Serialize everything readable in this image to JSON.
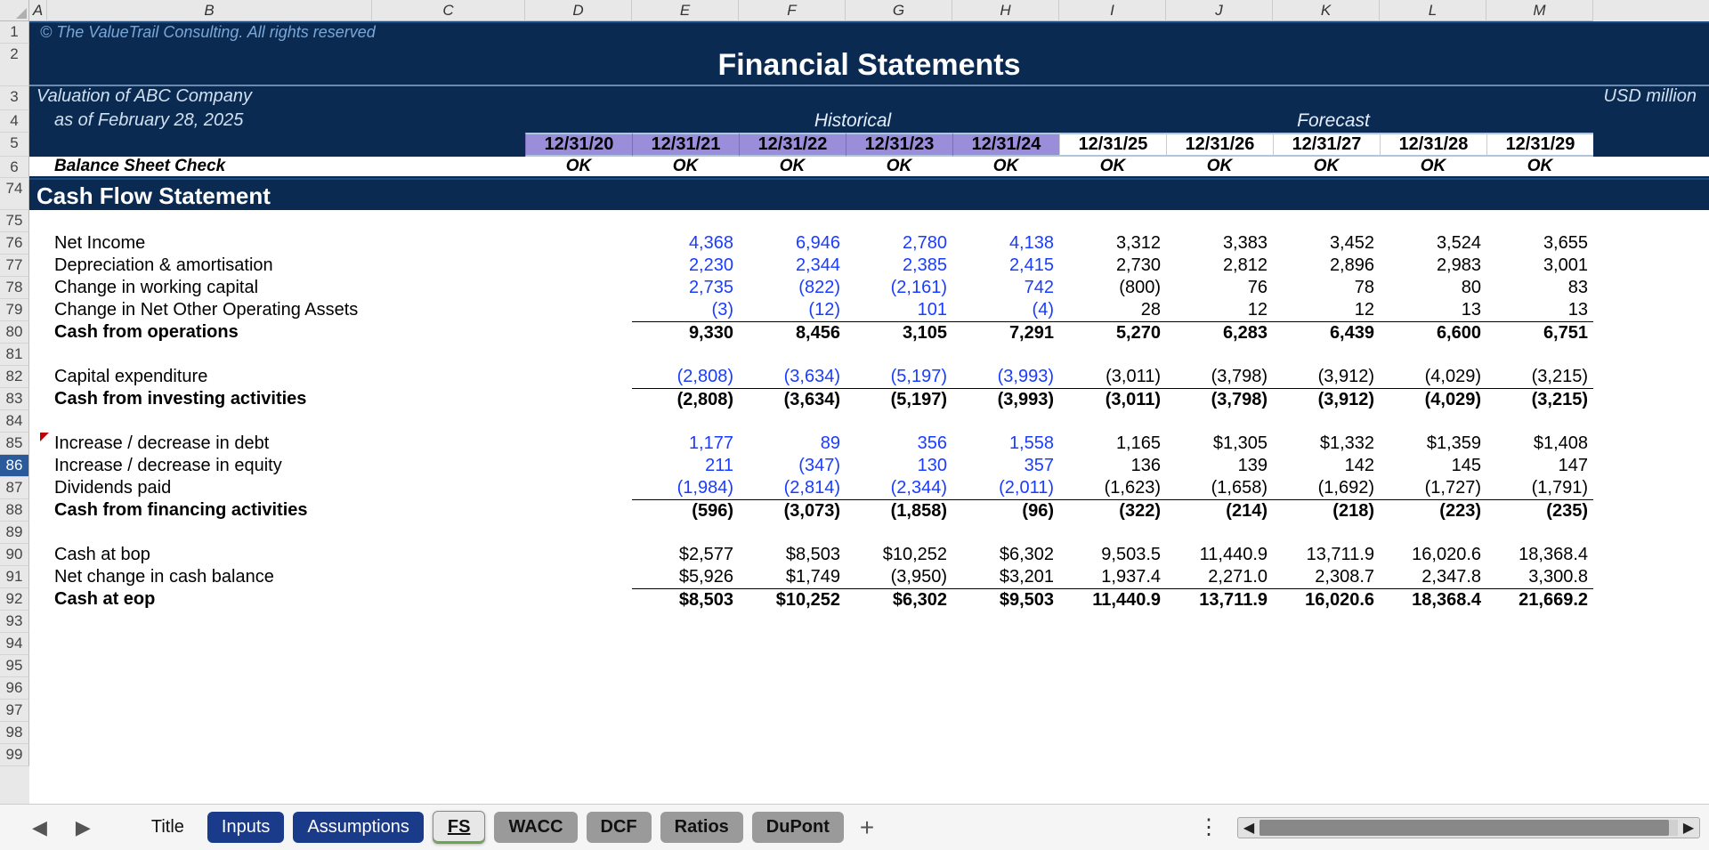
{
  "columns": [
    "A",
    "B",
    "C",
    "D",
    "E",
    "F",
    "G",
    "H",
    "I",
    "J",
    "K",
    "L",
    "M"
  ],
  "row_numbers_top": [
    1,
    2,
    3,
    4,
    5,
    6
  ],
  "row_numbers_mid": [
    74,
    75,
    76,
    77,
    78,
    79,
    80,
    81,
    82,
    83,
    84,
    85,
    86,
    87,
    88,
    89,
    90,
    91,
    92,
    93,
    94,
    95,
    96,
    97,
    98,
    99
  ],
  "selected_row": 86,
  "copyright": "© The ValueTrail Consulting. All rights reserved",
  "title": "Financial Statements",
  "subtitle1": "Valuation of  ABC Company",
  "subtitle2": "as of February 28, 2025",
  "section_hist": "Historical",
  "section_fore": "Forecast",
  "usd": "USD million",
  "dates": [
    "12/31/20",
    "12/31/21",
    "12/31/22",
    "12/31/23",
    "12/31/24",
    "12/31/25",
    "12/31/26",
    "12/31/27",
    "12/31/28",
    "12/31/29"
  ],
  "bs_check_label": "Balance Sheet Check",
  "ok": "OK",
  "section_header": "Cash Flow Statement",
  "rows": {
    "net_income": {
      "label": "Net Income",
      "blue": 4,
      "vals": [
        "4,368",
        "6,946",
        "2,780",
        "4,138",
        "3,312",
        "3,383",
        "3,452",
        "3,524",
        "3,655"
      ]
    },
    "dep_amort": {
      "label": "Depreciation & amortisation",
      "blue": 4,
      "vals": [
        "2,230",
        "2,344",
        "2,385",
        "2,415",
        "2,730",
        "2,812",
        "2,896",
        "2,983",
        "3,001"
      ]
    },
    "chg_wc": {
      "label": "Change in working capital",
      "blue": 4,
      "vals": [
        "2,735",
        "(822)",
        "(2,161)",
        "742",
        "(800)",
        "76",
        "78",
        "80",
        "83"
      ]
    },
    "chg_other": {
      "label": "Change in Net Other Operating Assets",
      "blue": 4,
      "vals": [
        "(3)",
        "(12)",
        "101",
        "(4)",
        "28",
        "12",
        "12",
        "13",
        "13"
      ]
    },
    "cash_ops": {
      "label": "Cash from operations",
      "bold": true,
      "sum": true,
      "vals": [
        "9,330",
        "8,456",
        "3,105",
        "7,291",
        "5,270",
        "6,283",
        "6,439",
        "6,600",
        "6,751"
      ]
    },
    "capex": {
      "label": "Capital expenditure",
      "blue": 4,
      "vals": [
        "(2,808)",
        "(3,634)",
        "(5,197)",
        "(3,993)",
        "(3,011)",
        "(3,798)",
        "(3,912)",
        "(4,029)",
        "(3,215)"
      ]
    },
    "cash_inv": {
      "label": "Cash from investing activities",
      "bold": true,
      "sum": true,
      "vals": [
        "(2,808)",
        "(3,634)",
        "(5,197)",
        "(3,993)",
        "(3,011)",
        "(3,798)",
        "(3,912)",
        "(4,029)",
        "(3,215)"
      ]
    },
    "chg_debt": {
      "label": "Increase / decrease in debt",
      "blue": 4,
      "vals": [
        "1,177",
        "89",
        "356",
        "1,558",
        "1,165",
        "$1,305",
        "$1,332",
        "$1,359",
        "$1,408"
      ]
    },
    "chg_equity": {
      "label": "Increase / decrease in equity",
      "blue": 4,
      "vals": [
        "211",
        "(347)",
        "130",
        "357",
        "136",
        "139",
        "142",
        "145",
        "147"
      ]
    },
    "div_paid": {
      "label": "Dividends paid",
      "blue": 4,
      "vals": [
        "(1,984)",
        "(2,814)",
        "(2,344)",
        "(2,011)",
        "(1,623)",
        "(1,658)",
        "(1,692)",
        "(1,727)",
        "(1,791)"
      ]
    },
    "cash_fin": {
      "label": "Cash from financing activities",
      "bold": true,
      "sum": true,
      "vals": [
        "(596)",
        "(3,073)",
        "(1,858)",
        "(96)",
        "(322)",
        "(214)",
        "(218)",
        "(223)",
        "(235)"
      ]
    },
    "cash_bop": {
      "label": "Cash at bop",
      "vals": [
        "$2,577",
        "$8,503",
        "$10,252",
        "$6,302",
        "9,503.5",
        "11,440.9",
        "13,711.9",
        "16,020.6",
        "18,368.4"
      ]
    },
    "net_change": {
      "label": "Net change in cash balance",
      "vals": [
        "$5,926",
        "$1,749",
        "(3,950)",
        "$3,201",
        "1,937.4",
        "2,271.0",
        "2,308.7",
        "2,347.8",
        "3,300.8"
      ]
    },
    "cash_eop": {
      "label": "Cash at eop",
      "bold": true,
      "sum": true,
      "vals": [
        "$8,503",
        "$10,252",
        "$6,302",
        "$9,503",
        "11,440.9",
        "13,711.9",
        "16,020.6",
        "18,368.4",
        "21,669.2"
      ]
    }
  },
  "row_order": [
    "net_income",
    "dep_amort",
    "chg_wc",
    "chg_other",
    "cash_ops",
    "",
    "capex",
    "cash_inv",
    "",
    "chg_debt",
    "chg_equity",
    "div_paid",
    "cash_fin",
    "",
    "cash_bop",
    "net_change",
    "cash_eop"
  ],
  "tabs": [
    {
      "name": "Title",
      "style": "plain"
    },
    {
      "name": "Inputs",
      "style": "blue"
    },
    {
      "name": "Assumptions",
      "style": "blue"
    },
    {
      "name": "FS",
      "style": "active"
    },
    {
      "name": "WACC",
      "style": "grey"
    },
    {
      "name": "DCF",
      "style": "grey"
    },
    {
      "name": "Ratios",
      "style": "grey"
    },
    {
      "name": "DuPont",
      "style": "grey"
    }
  ]
}
